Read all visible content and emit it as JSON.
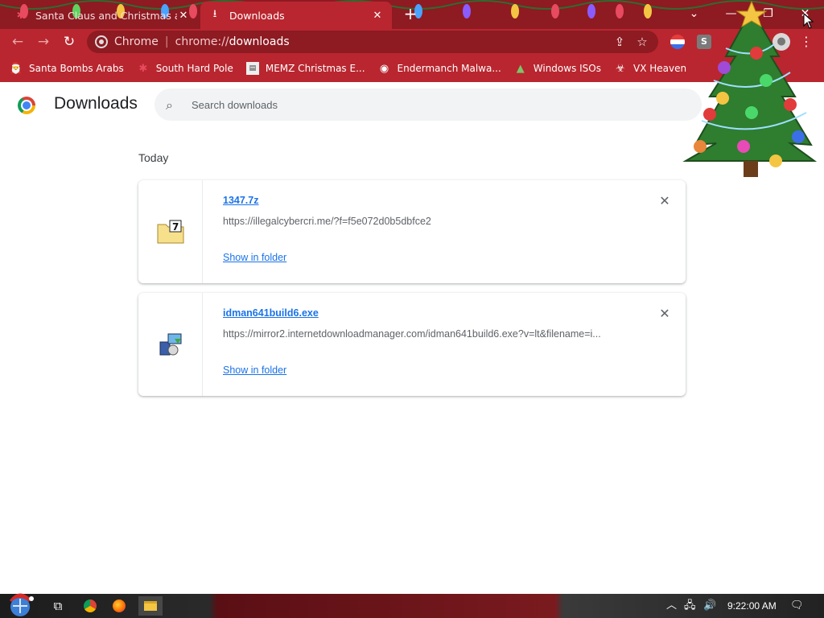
{
  "tabs": [
    {
      "title": "Santa Claus and Christmas at th",
      "active": false
    },
    {
      "title": "Downloads",
      "active": true
    }
  ],
  "omnibox": {
    "chip": "Chrome",
    "scheme": "chrome://",
    "host": "downloads"
  },
  "bookmarks": [
    {
      "label": "Santa Bombs Arabs"
    },
    {
      "label": "South Hard Pole"
    },
    {
      "label": "MEMZ Christmas E..."
    },
    {
      "label": "Endermanch Malwa..."
    },
    {
      "label": "Windows ISOs"
    },
    {
      "label": "VX Heaven"
    }
  ],
  "page": {
    "title": "Downloads",
    "search_placeholder": "Search downloads",
    "day_label": "Today"
  },
  "downloads": [
    {
      "filename": "1347.7z",
      "url": "https://illegalcybercri.me/?f=f5e072d0b5dbfce2",
      "show_label": "Show in folder",
      "icon": "7z-archive-icon"
    },
    {
      "filename": "idman641build6.exe",
      "url": "https://mirror2.internetdownloadmanager.com/idman641build6.exe?v=lt&filename=i...",
      "show_label": "Show in folder",
      "icon": "installer-icon"
    }
  ],
  "taskbar": {
    "clock": "9:22:00 AM"
  },
  "colors": {
    "tabstrip": "#8e1a22",
    "toolbar": "#b9262f",
    "link": "#1a73e8"
  }
}
